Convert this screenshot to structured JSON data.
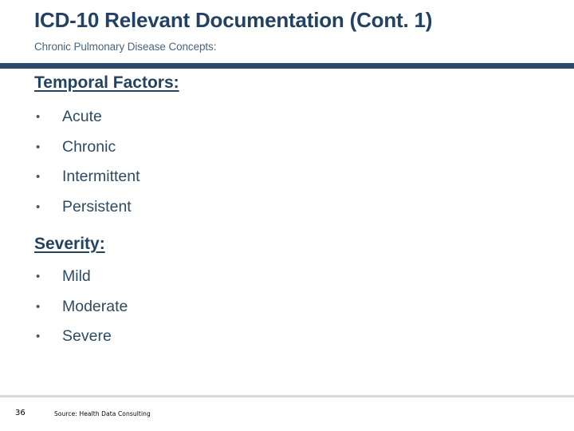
{
  "slide": {
    "title": "ICD-10 Relevant Documentation (Cont. 1)",
    "subtitle": "Chronic Pulmonary Disease Concepts:",
    "accent_color": "#294a6b",
    "title_color": "#234263",
    "subtitle_color": "#4a6480",
    "body_text_color": "#2d4b63",
    "divider_color": "#d9d9d9"
  },
  "sections": [
    {
      "heading": "Temporal Factors:",
      "bullet_glyph": "•",
      "items": [
        {
          "label": "Acute"
        },
        {
          "label": "Chronic"
        },
        {
          "label": "Intermittent"
        },
        {
          "label": "Persistent"
        }
      ]
    },
    {
      "heading": "Severity:",
      "bullet_glyph": "•",
      "items": [
        {
          "label": "Mild"
        },
        {
          "label": "Moderate"
        },
        {
          "label": "Severe"
        }
      ]
    }
  ],
  "footer": {
    "page_number": "36",
    "source": "Source:  Health Data Consulting"
  }
}
